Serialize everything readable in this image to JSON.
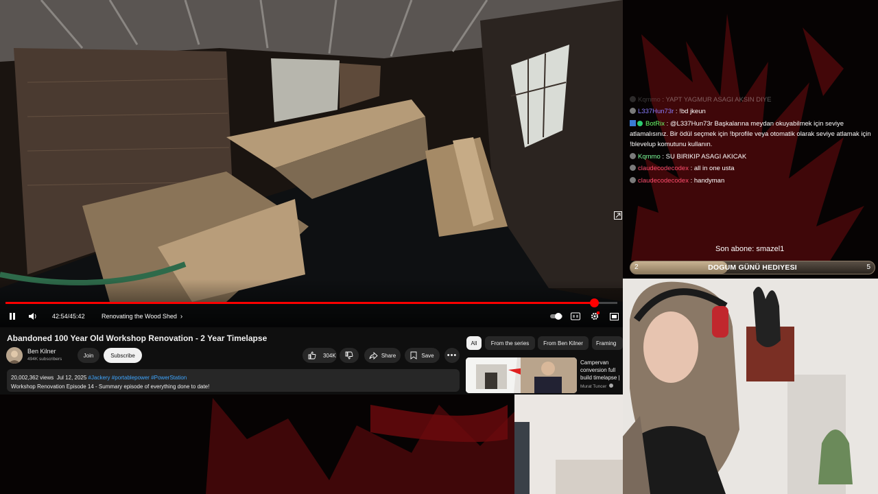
{
  "player": {
    "current_time": "42:54",
    "duration": "45:42",
    "time_separator": " / ",
    "chapter": "Renovating the Wood Shed",
    "progress": 0.962
  },
  "video": {
    "title": "Abandoned 100 Year Old Workshop Renovation - 2 Year Timelapse",
    "channel_name": "Ben Kilner",
    "subscribers": "494K subscribers",
    "join_label": "Join",
    "subscribe_label": "Subscribe",
    "likes": "304K",
    "share_label": "Share",
    "save_label": "Save",
    "views": "20,002,362 views",
    "date": "Jul 12, 2025",
    "hashtags": [
      "#Jackery",
      "#portablepower",
      "#PowerStation"
    ],
    "description": "Workshop Renovation Episode 14 - Summary episode of everything done to date!"
  },
  "chips": [
    "All",
    "From the series",
    "From Ben Kilner",
    "Framing"
  ],
  "recommendation": {
    "title": "Campervan conversion full build timelapse | vw crafter",
    "channel": "Murat Tuncer"
  },
  "chat": {
    "messages": [
      {
        "user": "Kqmmo",
        "sep": " : ",
        "text": "YAPT YAGMUR ASAGI AKSIN DIYE",
        "color": "#9b9b9b"
      },
      {
        "user": "L337Hun73r",
        "sep": " : ",
        "text": "!bd jkeun",
        "color": "#8a7dff"
      },
      {
        "user": "BotRix",
        "sep": " : ",
        "text": "@L337Hun73r Başkalarına meydan okuyabilmek için seviye atlamalısınız. Bir ödül seçmek için !bprofile veya otomatik olarak seviye atlamak için !blevelup komutunu kullanın.",
        "color": "#6bff6b"
      },
      {
        "user": "Kqmmo",
        "sep": " : ",
        "text": "SU BIRIKIP ASAGI AKICAK",
        "color": "#7dff9a"
      },
      {
        "user": "claudecodecodex",
        "sep": " : ",
        "text": "all in one usta",
        "color": "#ff4d6d"
      },
      {
        "user": "claudecodecodex",
        "sep": " : ",
        "text": "handyman",
        "color": "#ff4d6d"
      }
    ],
    "last_sub": "Son abone: smazel1",
    "goal": {
      "left": "2",
      "title": "DOGUM GÜNÜ HEDIYESI",
      "right": "5",
      "progress": 0.4
    }
  },
  "colors": {
    "accent": "#ff0000",
    "link": "#3ea6ff",
    "chip_bg": "#272727"
  }
}
